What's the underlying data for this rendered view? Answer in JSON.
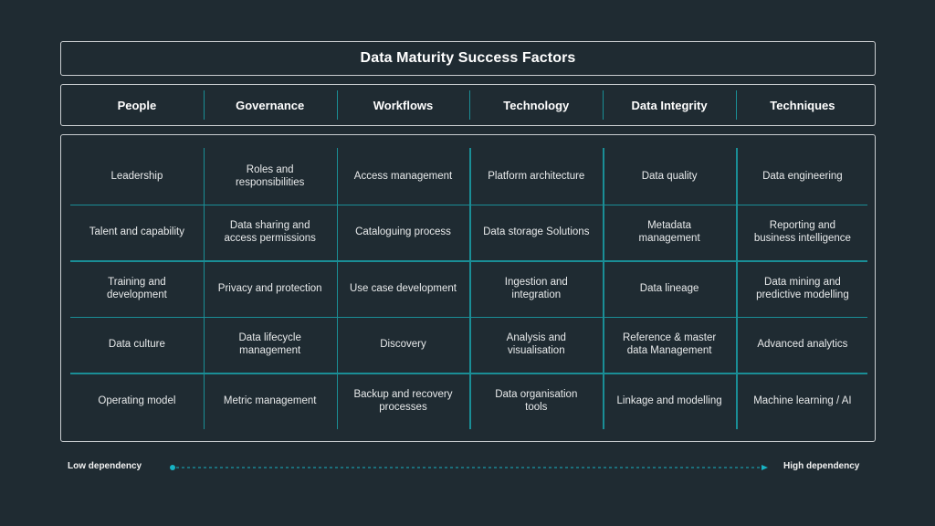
{
  "title": "Data Maturity Success Factors",
  "columns": [
    "People",
    "Governance",
    "Workflows",
    "Technology",
    "Data Integrity",
    "Techniques"
  ],
  "rows": [
    [
      "Leadership",
      "Roles and\nresponsibilities",
      "Access management",
      "Platform architecture",
      "Data quality",
      "Data engineering"
    ],
    [
      "Talent and capability",
      "Data sharing and\naccess permissions",
      "Cataloguing  process",
      "Data storage Solutions",
      "Metadata\nmanagement",
      "Reporting and\nbusiness intelligence"
    ],
    [
      "Training and\ndevelopment",
      "Privacy and protection",
      "Use case development",
      "Ingestion and\nintegration",
      "Data lineage",
      "Data mining and\npredictive modelling"
    ],
    [
      "Data culture",
      "Data lifecycle\nmanagement",
      "Discovery",
      "Analysis and\nvisualisation",
      "Reference & master\ndata Management",
      "Advanced analytics"
    ],
    [
      "Operating model",
      "Metric management",
      "Backup and recovery\nprocesses",
      "Data organisation\ntools",
      "Linkage and modelling",
      "Machine learning / AI"
    ]
  ],
  "legend": {
    "low_label": "Low dependency",
    "high_label": "High dependency",
    "arrow_icon": "dashed-arrow-right"
  },
  "colors": {
    "background": "#1f2b32",
    "grid_line": "#1a8e96",
    "border": "#c9cdd0",
    "arrow": "#17b3c4"
  }
}
